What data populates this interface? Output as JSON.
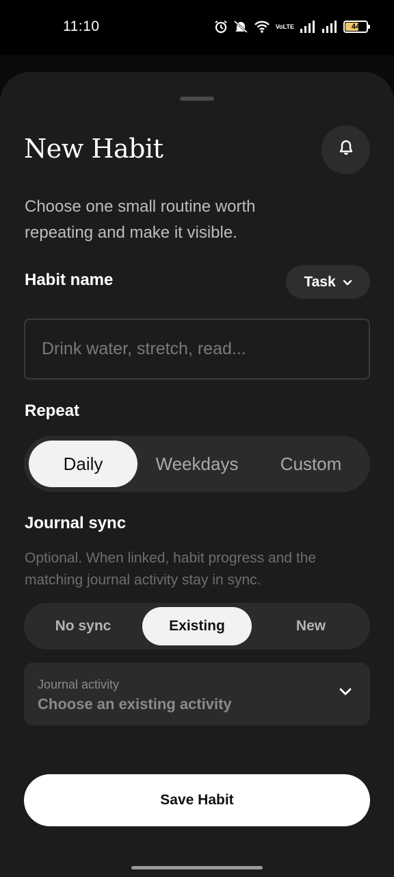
{
  "status_bar": {
    "time": "11:10",
    "battery": "44",
    "network_label": "VoLTE",
    "icons": [
      "alarm-icon",
      "mute-icon",
      "wifi-icon",
      "volte-icon",
      "signal-icon",
      "signal-icon",
      "battery-icon"
    ]
  },
  "sheet": {
    "title": "New Habit",
    "subtitle": "Choose one small routine worth repeating and make it visible.",
    "bell_icon": "bell-icon"
  },
  "habit_name": {
    "label": "Habit name",
    "type_chip": "Task",
    "placeholder": "Drink water, stretch, read..."
  },
  "repeat": {
    "label": "Repeat",
    "options": [
      "Daily",
      "Weekdays",
      "Custom"
    ],
    "selected": "Daily"
  },
  "journal_sync": {
    "label": "Journal sync",
    "description": "Optional. When linked, habit progress and the matching journal activity stay in sync.",
    "options": [
      "No sync",
      "Existing",
      "New"
    ],
    "selected": "Existing",
    "activity_label": "Journal activity",
    "activity_placeholder": "Choose an existing activity"
  },
  "actions": {
    "save_label": "Save Habit"
  },
  "colors": {
    "sheet_bg": "#1c1c1c",
    "segment_bg": "#2b2b2b",
    "active_pill": "#f2f2f2",
    "primary_button": "#ffffff"
  }
}
